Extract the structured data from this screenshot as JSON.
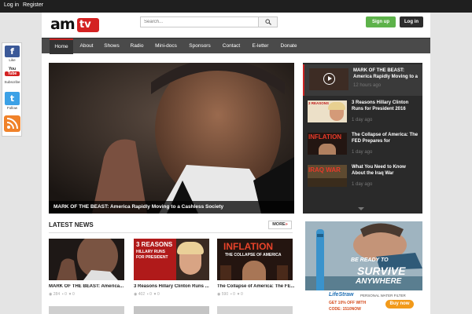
{
  "topbar": {
    "login": "Log in",
    "register": "Register"
  },
  "header": {
    "logo_am": "am",
    "logo_tv": "tv",
    "search_placeholder": "Search...",
    "signup": "Sign up",
    "login": "Log in"
  },
  "nav": {
    "items": [
      "Home",
      "About",
      "Shows",
      "Radio",
      "Mini-docs",
      "Sponsors",
      "Contact",
      "E-letter",
      "Donate"
    ],
    "active": "Home"
  },
  "featured": {
    "caption": "MARK OF THE BEAST: America Rapidly Moving to a Cashless Society"
  },
  "sidebar_items": [
    {
      "title": "MARK OF THE BEAST: America Rapidly Moving to a",
      "time": "12 hours ago",
      "thumb_text": ""
    },
    {
      "title": "3 Reasons Hillary Clinton Runs for President 2016",
      "time": "1 day ago",
      "thumb_text": "3 REASONS"
    },
    {
      "title": "The Collapse of America: The FED Prepares for",
      "time": "1 day ago",
      "thumb_text": "INFLATION"
    },
    {
      "title": "What You Need to Know About the Iraq War",
      "time": "1 day ago",
      "thumb_text": "IRAQ WAR"
    }
  ],
  "latest": {
    "heading": "LATEST NEWS",
    "more": "MORE",
    "more_arrow": "»",
    "cards": [
      {
        "title": "MARK OF THE BEAST: America...",
        "views": "284",
        "comments": "0",
        "likes": "0"
      },
      {
        "title": "3 Reasons Hillary Clinton Runs ...",
        "views": "402",
        "comments": "0",
        "likes": "0",
        "thumb_line1": "3 REASONS",
        "thumb_line2": "HILLARY RUNS",
        "thumb_line3": "FOR PRESIDENT"
      },
      {
        "title": "The Collapse of America: The FE...",
        "views": "590",
        "comments": "0",
        "likes": "0",
        "thumb_line1": "INFLATION",
        "thumb_line2": "THE COLLAPSE OF AMERICA"
      }
    ]
  },
  "ad": {
    "line1": "BE READY TO",
    "line2": "SURVIVE",
    "line3": "ANYWHERE",
    "brand": "LifeStraw",
    "tagline": "PERSONAL WATER FILTER",
    "offer": "GET 10% OFF WITH",
    "code": "CODE: 1510NOW",
    "buy": "Buy now"
  },
  "social": {
    "facebook": "Like",
    "youtube_top": "You",
    "youtube_bottom": "Tube",
    "subscribe": "Subscribe",
    "twitter": "Follow"
  }
}
